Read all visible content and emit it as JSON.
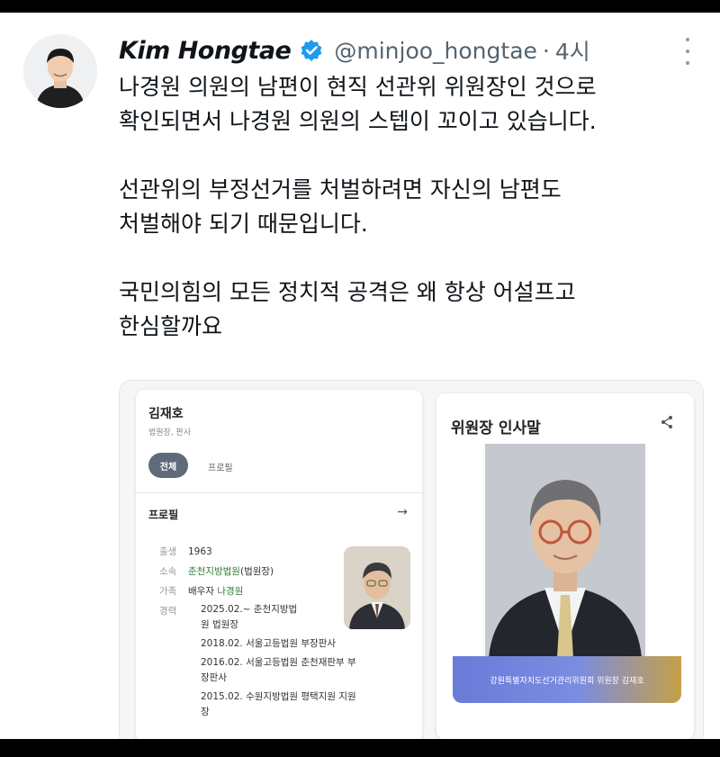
{
  "tweet": {
    "author_name": "Kim Hongtae",
    "handle": "@minjoo_hongtae",
    "separator": "·",
    "time": "4시",
    "paragraphs": [
      [
        "나경원 의원의 남편이 현직 선관위 위원장인 것으로",
        "확인되면서 나경원 의원의 스텝이 꼬이고 있습니다."
      ],
      [
        "선관위의 부정선거를 처벌하려면 자신의 남편도",
        "처벌해야 되기 때문입니다."
      ],
      [
        "국민의힘의 모든 정치적 공격은 왜 항상 어설프고",
        "한심할까요"
      ]
    ],
    "colors": {
      "verified": "#1d9bf0",
      "text": "#0f1419",
      "muted": "#536471"
    }
  },
  "profile_card": {
    "name": "김재호",
    "subtitle": "법원장, 판사",
    "tab_all": "전체",
    "tab_profile": "프로필",
    "section_title": "프로필",
    "birth_label": "출생",
    "birth_value": "1963",
    "affil_label": "소속",
    "affil_link": "춘천지방법원",
    "affil_suffix": "(법원장)",
    "family_label": "가족",
    "family_prefix": "배우자 ",
    "family_link": "나경원",
    "career_label": "경력",
    "career": [
      "2025.02.~ 춘천지방법",
      "원 법원장",
      "2018.02. 서울고등법원 부장판사",
      "2016.02. 서울고등법원 춘천재판부 부",
      "장판사",
      "2015.02. 수원지방법원 평택지원 지원",
      "장"
    ]
  },
  "greeting_card": {
    "title": "위원장 인사말",
    "banner": "강원특별자치도선거관리위원회 위원장 김재호"
  }
}
